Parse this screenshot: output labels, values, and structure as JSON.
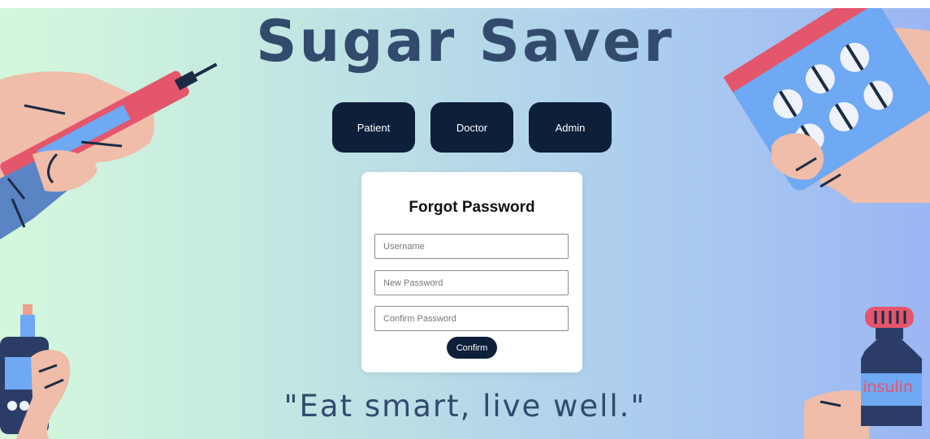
{
  "header": {
    "title": "Sugar Saver"
  },
  "roles": {
    "patient": "Patient",
    "doctor": "Doctor",
    "admin": "Admin"
  },
  "form": {
    "title": "Forgot Password",
    "username_placeholder": "Username",
    "new_password_placeholder": "New Password",
    "confirm_password_placeholder": "Confirm Password",
    "confirm_label": "Confirm"
  },
  "tagline": "\"Eat smart, live well.\"",
  "illustrations": {
    "insulin_label": "insulin"
  },
  "colors": {
    "title": "#324a6c",
    "button": "#0e1f3a",
    "accent_red": "#e4566b",
    "accent_blue": "#6fa8f3",
    "skin": "#efbda9"
  }
}
